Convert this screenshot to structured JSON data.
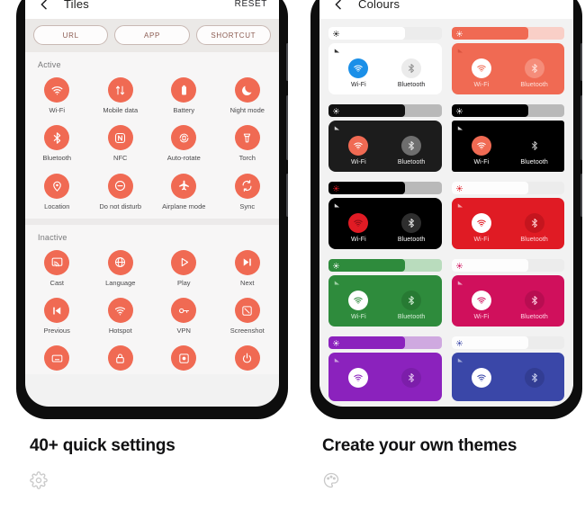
{
  "theme_colors": {
    "accent_coral": "#f06a53",
    "page_bg": "#ffffff",
    "screen_bg": "#f2f2f2",
    "bezel": "#0d0d0d"
  },
  "left_phone": {
    "appbar": {
      "back_icon": "chevron-left-icon",
      "title": "Tiles",
      "reset_label": "RESET"
    },
    "chips": [
      {
        "label": "URL"
      },
      {
        "label": "APP"
      },
      {
        "label": "SHORTCUT"
      }
    ],
    "sections": [
      {
        "label": "Active",
        "tiles": [
          {
            "label": "Wi-Fi",
            "icon": "wifi-icon"
          },
          {
            "label": "Mobile data",
            "icon": "mobile-data-icon"
          },
          {
            "label": "Battery",
            "icon": "battery-icon"
          },
          {
            "label": "Night mode",
            "icon": "moon-icon"
          },
          {
            "label": "Bluetooth",
            "icon": "bluetooth-icon"
          },
          {
            "label": "NFC",
            "icon": "nfc-icon"
          },
          {
            "label": "Auto-rotate",
            "icon": "auto-rotate-icon"
          },
          {
            "label": "Torch",
            "icon": "torch-icon"
          },
          {
            "label": "Location",
            "icon": "location-pin-icon"
          },
          {
            "label": "Do not disturb",
            "icon": "do-not-disturb-icon"
          },
          {
            "label": "Airplane mode",
            "icon": "airplane-icon"
          },
          {
            "label": "Sync",
            "icon": "sync-icon"
          }
        ]
      },
      {
        "label": "Inactive",
        "tiles": [
          {
            "label": "Cast",
            "icon": "cast-icon"
          },
          {
            "label": "Language",
            "icon": "globe-icon"
          },
          {
            "label": "Play",
            "icon": "play-icon"
          },
          {
            "label": "Next",
            "icon": "next-track-icon"
          },
          {
            "label": "Previous",
            "icon": "previous-track-icon"
          },
          {
            "label": "Hotspot",
            "icon": "hotspot-icon"
          },
          {
            "label": "VPN",
            "icon": "vpn-key-icon"
          },
          {
            "label": "Screenshot",
            "icon": "screenshot-icon"
          }
        ],
        "cut_off_tiles": [
          {
            "label": "",
            "icon": "keyboard-icon"
          },
          {
            "label": "",
            "icon": "lock-icon"
          },
          {
            "label": "",
            "icon": "screen-record-icon"
          },
          {
            "label": "",
            "icon": "power-icon"
          }
        ]
      }
    ]
  },
  "right_phone": {
    "appbar": {
      "back_icon": "chevron-left-icon",
      "title": "Colours"
    },
    "themes": [
      {
        "name": "light-blue",
        "slider_fill": "#ffffff",
        "slider_rest": "#ececec",
        "sun_color": "#1e1e1e",
        "card_bg": "#ffffff",
        "card_radius": "7px",
        "sig_color": "#333333",
        "wifi_bg": "#1a8fe8",
        "wifi_glyph": "#ffffff",
        "bt_bg": "#ebebeb",
        "bt_glyph": "#8d8d8d",
        "label_color": "#1d1d1f",
        "wifi_label": "Wi-Fi",
        "bt_label": "Bluetooth"
      },
      {
        "name": "coral",
        "slider_fill": "#f06a53",
        "slider_rest": "#f9cfc7",
        "sun_color": "#ffffff",
        "card_bg": "#f06a53",
        "card_radius": "7px",
        "sig_color": "#d8533e",
        "wifi_bg": "#ffffff",
        "wifi_glyph": "#f06a53",
        "bt_bg": "#f58d7a",
        "bt_glyph": "#ffe2dc",
        "label_color": "#fde3dd",
        "wifi_label": "Wi-Fi",
        "bt_label": "Bluetooth"
      },
      {
        "name": "dark-grey",
        "slider_fill": "#111111",
        "slider_rest": "#b9b9b9",
        "sun_color": "#ffffff",
        "card_bg": "#1c1c1c",
        "card_radius": "8px",
        "sig_color": "#cfcfcf",
        "wifi_bg": "#f06a53",
        "wifi_glyph": "#ffffff",
        "bt_bg": "#6e6e6e",
        "bt_glyph": "#e9e9e9",
        "label_color": "#f2f2f2",
        "wifi_label": "Wi-Fi",
        "bt_label": "Bluetooth"
      },
      {
        "name": "amoled-black",
        "slider_fill": "#000000",
        "slider_rest": "#b9b9b9",
        "sun_color": "#ffffff",
        "card_bg": "#000000",
        "card_radius": "3px",
        "sig_color": "#d8d8d8",
        "wifi_bg": "#f06a53",
        "wifi_glyph": "#ffffff",
        "bt_bg": "#000000",
        "bt_glyph": "#c8c8c8",
        "label_color": "#ffffff",
        "wifi_label": "Wi-Fi",
        "bt_label": "Bluetooth"
      },
      {
        "name": "black-red",
        "slider_fill": "#000000",
        "slider_rest": "#b9b9b9",
        "sun_color": "#e01b24",
        "card_bg": "#000000",
        "card_radius": "8px",
        "sig_color": "#d8d8d8",
        "wifi_bg": "#e01b24",
        "wifi_glyph": "#8d0f16",
        "bt_bg": "#2e2e2e",
        "bt_glyph": "#e9e9e9",
        "label_color": "#ffffff",
        "wifi_label": "Wi-Fi",
        "bt_label": "Bluetooth"
      },
      {
        "name": "red",
        "slider_fill": "#fdfdfd",
        "slider_rest": "#ececec",
        "sun_color": "#e01b24",
        "card_bg": "#e01b24",
        "card_radius": "7px",
        "sig_color": "#f2a6a8",
        "wifi_bg": "#ffffff",
        "wifi_glyph": "#e01b24",
        "bt_bg": "#c5151e",
        "bt_glyph": "#ffd4d6",
        "label_color": "#ffd9db",
        "wifi_label": "Wi-Fi",
        "bt_label": "Bluetooth"
      },
      {
        "name": "green",
        "slider_fill": "#2e8b3c",
        "slider_rest": "#b9dcbd",
        "sun_color": "#ffffff",
        "card_bg": "#2e8b3c",
        "card_radius": "7px",
        "sig_color": "#9ed0a4",
        "wifi_bg": "#ffffff",
        "wifi_glyph": "#2e8b3c",
        "bt_bg": "#277a33",
        "bt_glyph": "#d6f0d9",
        "label_color": "#d8f0da",
        "wifi_label": "Wi-Fi",
        "bt_label": "Bluetooth"
      },
      {
        "name": "pink",
        "slider_fill": "#fdfdfd",
        "slider_rest": "#ececec",
        "sun_color": "#d0105c",
        "card_bg": "#d0105c",
        "card_radius": "7px",
        "sig_color": "#eba2c0",
        "wifi_bg": "#ffffff",
        "wifi_glyph": "#d0105c",
        "bt_bg": "#b80d51",
        "bt_glyph": "#ffd0e2",
        "label_color": "#ffd5e4",
        "wifi_label": "Wi-Fi",
        "bt_label": "Bluetooth"
      },
      {
        "name": "purple",
        "slider_fill": "#8b22bd",
        "slider_rest": "#cfa9e0",
        "sun_color": "#ffffff",
        "card_bg": "#8b22bd",
        "card_radius": "7px",
        "sig_color": "#cba1dd",
        "wifi_bg": "#ffffff",
        "wifi_glyph": "#8b22bd",
        "bt_bg": "#7c1eaa",
        "bt_glyph": "#e6c9f2",
        "label_color": "#ecd6f5",
        "wifi_label": "",
        "bt_label": ""
      },
      {
        "name": "indigo",
        "slider_fill": "#fdfdfd",
        "slider_rest": "#ececec",
        "sun_color": "#3a47a8",
        "card_bg": "#3a47a8",
        "card_radius": "7px",
        "sig_color": "#a3abd9",
        "wifi_bg": "#ffffff",
        "wifi_glyph": "#3a47a8",
        "bt_bg": "#323d93",
        "bt_glyph": "#ccd2f0",
        "label_color": "#d4d9f4",
        "wifi_label": "",
        "bt_label": ""
      }
    ]
  },
  "captions": [
    {
      "title": "40+ quick settings",
      "icon": "gear-icon"
    },
    {
      "title": "Create your own themes",
      "icon": "palette-icon"
    }
  ]
}
